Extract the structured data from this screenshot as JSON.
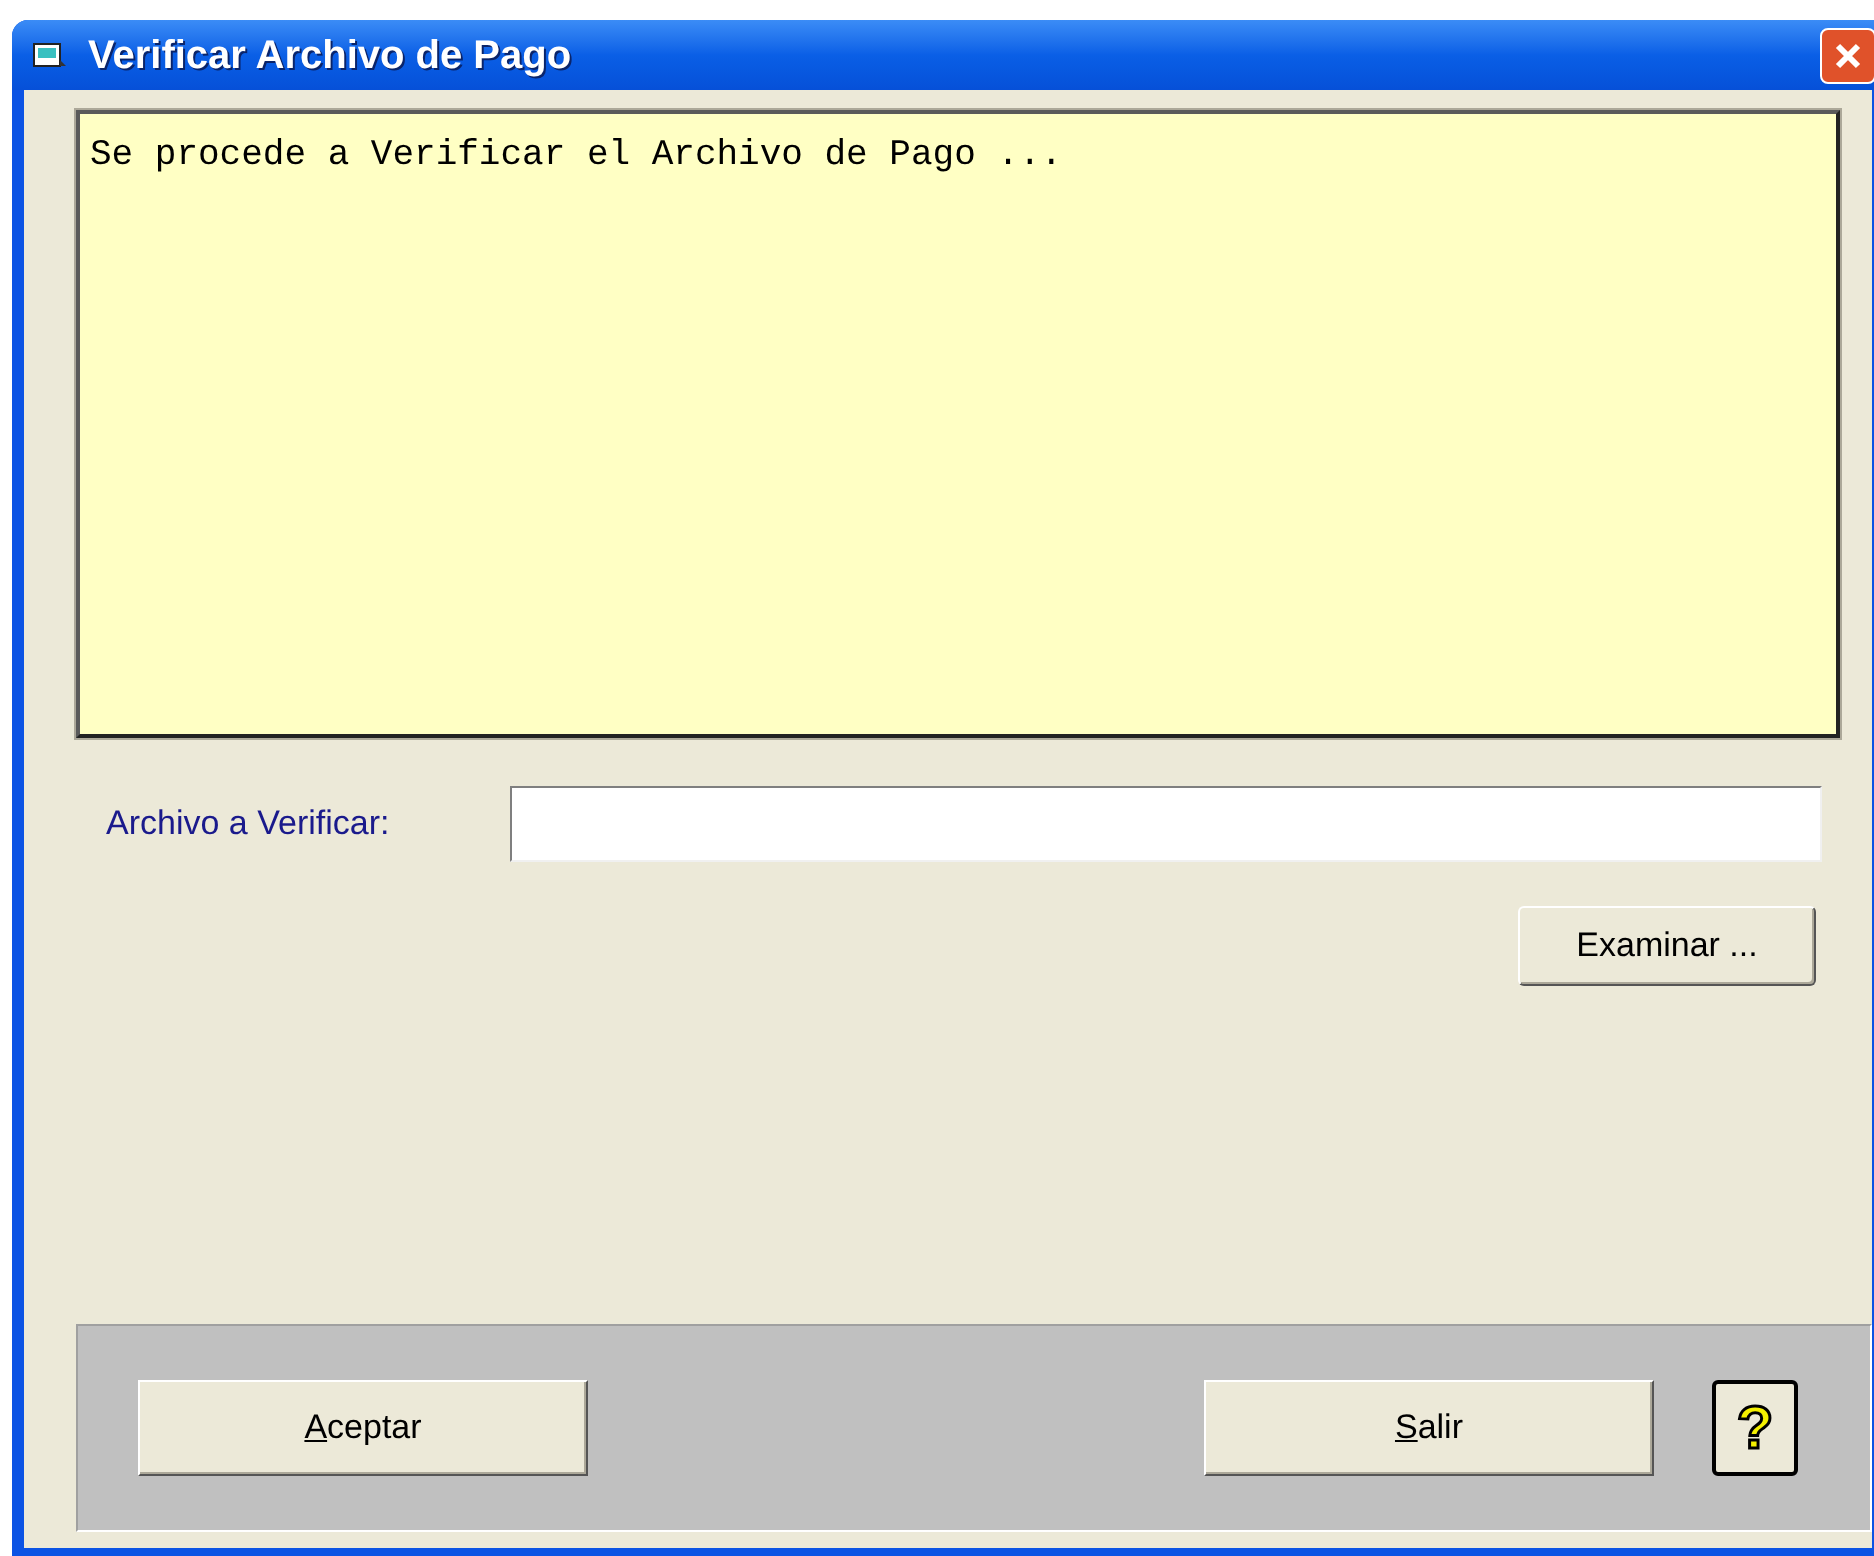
{
  "window": {
    "title": "Verificar Archivo de Pago"
  },
  "message_box": {
    "text": "Se procede a Verificar el Archivo de Pago ..."
  },
  "file_field": {
    "label": "Archivo a Verificar:"
  },
  "browse_button": {
    "label": "Examinar ..."
  },
  "footer_buttons": [
    {
      "label": "Aceptar",
      "underline_first": true
    },
    {
      "label": "Salir",
      "underline_first": true
    }
  ],
  "help_button": {
    "label": "?"
  }
}
